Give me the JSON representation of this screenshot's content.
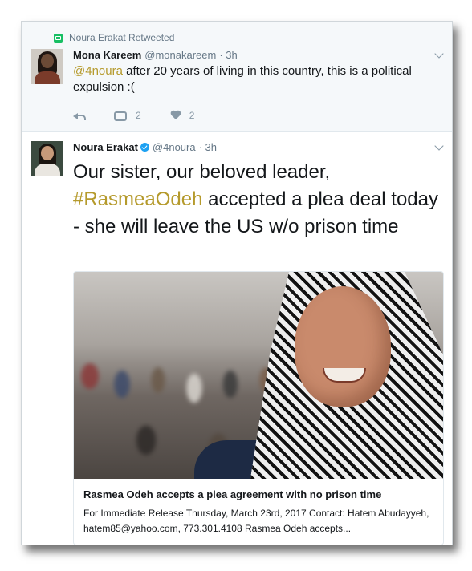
{
  "retweet": {
    "retweeted_by": "Noura Erakat Retweeted",
    "author_name": "Mona Kareem",
    "author_handle": "@monakareem",
    "time": "· 3h",
    "mention": "@4noura",
    "text": " after 20 years of living in this country, this is a political expulsion :(",
    "retweet_count": "2",
    "like_count": "2"
  },
  "main_tweet": {
    "author_name": "Noura Erakat",
    "author_handle": "@4noura",
    "time": "· 3h",
    "text_before": "Our sister, our beloved leader, ",
    "hashtag": "#RasmeaOdeh",
    "text_after": " accepted a plea deal today - she will leave the US w/o prison time",
    "card": {
      "title": "Rasmea Odeh accepts a plea agreement with no prison time",
      "description": "For Immediate Release Thursday, March 23rd, 2017 Contact: Hatem Abudayyeh, hatem85@yahoo.com, 773.301.4108 Rasmea Odeh accepts..."
    }
  },
  "icons": [
    "retweet-icon",
    "reply-icon",
    "heart-icon",
    "verified-icon",
    "chevron-down-icon"
  ],
  "colors": {
    "link": "#b59a2c",
    "retweet_green": "#17bf63",
    "verified_blue": "#1da1f2",
    "muted": "#657786"
  }
}
